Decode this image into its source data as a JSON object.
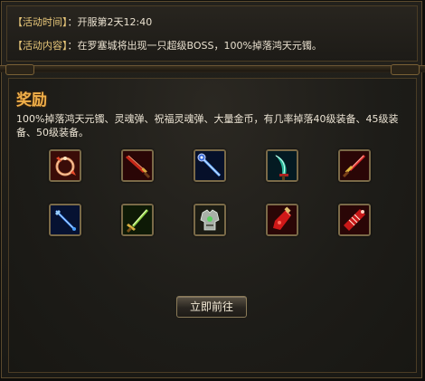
{
  "event": {
    "time_label": "【活动时间】",
    "time_value": "：开服第2天12:40",
    "content_label": "【活动内容】",
    "content_value": "：在罗塞城将出现一只超级BOSS，100%掉落鸿天元镯。"
  },
  "reward": {
    "title": "奖励",
    "description": "100%掉落鸿天元镯、灵魂弹、祝福灵魂弹、大量金币，有几率掉落40级装备、45级装备、50级装备。",
    "items": [
      {
        "icon": "bracelet-icon",
        "bg": "#3a0c08"
      },
      {
        "icon": "red-sword-icon",
        "bg": "#2a0606"
      },
      {
        "icon": "blue-staff-icon",
        "bg": "#06102a"
      },
      {
        "icon": "jade-blade-icon",
        "bg": "#041a22"
      },
      {
        "icon": "crimson-dagger-icon",
        "bg": "#2a0606"
      },
      {
        "icon": "ice-staff-icon",
        "bg": "#061232"
      },
      {
        "icon": "green-sword-icon",
        "bg": "#0e1a06"
      },
      {
        "icon": "armor-icon",
        "bg": "#1c1c14"
      },
      {
        "icon": "red-potion-icon",
        "bg": "#2a0606"
      },
      {
        "icon": "red-scroll-icon",
        "bg": "#2a0606"
      }
    ],
    "button_label": "立即前往"
  }
}
